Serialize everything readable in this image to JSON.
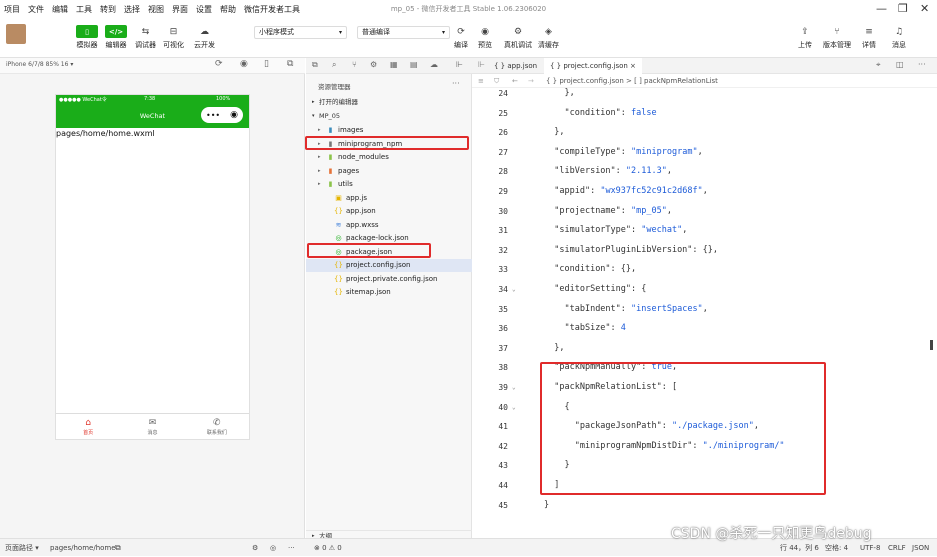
{
  "menu": [
    "项目",
    "文件",
    "编辑",
    "工具",
    "转到",
    "选择",
    "视图",
    "界面",
    "设置",
    "帮助",
    "微信开发者工具"
  ],
  "window_title": "mp_05 - 微信开发者工具 Stable 1.06.2306020",
  "toolbar": {
    "left_buttons": [
      {
        "icon": "phone-icon",
        "label": "模拟器"
      },
      {
        "icon": "code-icon",
        "label": "编辑器"
      },
      {
        "icon": "debug-icon",
        "label": "调试器"
      },
      {
        "icon": "visual-icon",
        "label": "可视化"
      },
      {
        "icon": "cloud-icon",
        "label": "云开发"
      }
    ],
    "mode_select": "小程序模式",
    "compile_select": "普通编译",
    "mid_buttons": [
      {
        "icon": "refresh-icon",
        "label": "编译"
      },
      {
        "icon": "eye-icon",
        "label": "预览"
      },
      {
        "icon": "gear-icon",
        "label": "真机调试"
      },
      {
        "icon": "layers-icon",
        "label": "清缓存"
      }
    ],
    "right_buttons": [
      {
        "icon": "upload-icon",
        "label": "上传"
      },
      {
        "icon": "branch-icon",
        "label": "版本管理"
      },
      {
        "icon": "menu-icon",
        "label": "详情"
      },
      {
        "icon": "bell-icon",
        "label": "消息"
      }
    ]
  },
  "simulator": {
    "device": "iPhone 6/7/8 85% 16 ▾",
    "status_left": "●●●●● WeChat令",
    "status_time": "7:38",
    "status_right": "100%",
    "nav_title": "WeChat",
    "page_text": "pages/home/home.wxml",
    "tabs": [
      {
        "icon": "home-icon",
        "label": "首页",
        "active": true
      },
      {
        "icon": "chat-icon",
        "label": "消息",
        "active": false
      },
      {
        "icon": "phone-call-icon",
        "label": "联系我们",
        "active": false
      }
    ]
  },
  "explorer": {
    "title": "资源管理器",
    "more": "···",
    "open_editors": "打开的编辑器",
    "project": "MP_05",
    "items": [
      {
        "name": "images",
        "kind": "folder",
        "color": "#3c8dbc"
      },
      {
        "name": "miniprogram_npm",
        "kind": "folder",
        "color": "#777777"
      },
      {
        "name": "node_modules",
        "kind": "folder",
        "color": "#8bc34a"
      },
      {
        "name": "pages",
        "kind": "folder",
        "color": "#e57339"
      },
      {
        "name": "utils",
        "kind": "folder",
        "color": "#8bc34a"
      },
      {
        "name": "app.js",
        "kind": "js",
        "color": "#e5b500"
      },
      {
        "name": "app.json",
        "kind": "json",
        "color": "#e5b500"
      },
      {
        "name": "app.wxss",
        "kind": "wxss",
        "color": "#3c7dd8"
      },
      {
        "name": "package-lock.json",
        "kind": "lock",
        "color": "#1aad19"
      },
      {
        "name": "package.json",
        "kind": "pkg",
        "color": "#1aad19"
      },
      {
        "name": "project.config.json",
        "kind": "json",
        "color": "#e5b500"
      },
      {
        "name": "project.private.config.json",
        "kind": "json",
        "color": "#e5b500"
      },
      {
        "name": "sitemap.json",
        "kind": "json",
        "color": "#e5b500"
      }
    ],
    "outline": "大纲"
  },
  "editor": {
    "tabs": [
      "{ } app.json",
      "{ } project.config.json ×"
    ],
    "breadcrumb": "{ } project.config.json > [ ] packNpmRelationList",
    "lines": [
      {
        "n": "24",
        "text": "    },"
      },
      {
        "n": "25",
        "text": "    \"condition\": false"
      },
      {
        "n": "26",
        "text": "  },"
      },
      {
        "n": "27",
        "text": "  \"compileType\": \"miniprogram\","
      },
      {
        "n": "28",
        "text": "  \"libVersion\": \"2.11.3\","
      },
      {
        "n": "29",
        "text": "  \"appid\": \"wx937fc52c91c2d68f\","
      },
      {
        "n": "30",
        "text": "  \"projectname\": \"mp_05\","
      },
      {
        "n": "31",
        "text": "  \"simulatorType\": \"wechat\","
      },
      {
        "n": "32",
        "text": "  \"simulatorPluginLibVersion\": {},"
      },
      {
        "n": "33",
        "text": "  \"condition\": {},"
      },
      {
        "n": "34",
        "text": "  \"editorSetting\": {"
      },
      {
        "n": "35",
        "text": "    \"tabIndent\": \"insertSpaces\","
      },
      {
        "n": "36",
        "text": "    \"tabSize\": 4"
      },
      {
        "n": "37",
        "text": "  },"
      },
      {
        "n": "38",
        "text": "  \"packNpmManually\": true,"
      },
      {
        "n": "39",
        "text": "  \"packNpmRelationList\": ["
      },
      {
        "n": "40",
        "text": "    {"
      },
      {
        "n": "41",
        "text": "      \"packageJsonPath\": \"./package.json\","
      },
      {
        "n": "42",
        "text": "      \"miniprogramNpmDistDir\": \"./miniprogram/\""
      },
      {
        "n": "43",
        "text": "    }"
      },
      {
        "n": "44",
        "text": "  ]"
      },
      {
        "n": "45",
        "text": "}"
      }
    ]
  },
  "statusbar": {
    "path_label": "页面路径 ▾",
    "path": "pages/home/home",
    "problems": "⊗ 0 ⚠ 0",
    "position": "行 44，列 6",
    "spaces": "空格: 4",
    "encoding": "UTF-8",
    "eol": "CRLF",
    "lang": "JSON"
  },
  "watermark": "CSDN @杀死一只知更鸟debug",
  "colors": {
    "accent": "#1aad19",
    "highlight": "#e02b2b",
    "string": "#1d5bd8"
  }
}
